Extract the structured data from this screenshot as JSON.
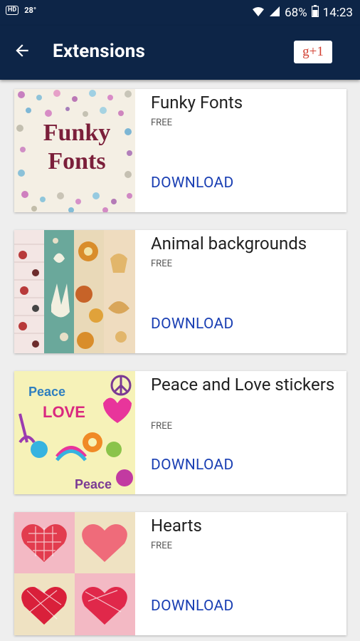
{
  "status_bar": {
    "left_icons": [
      "hd-voice-icon",
      "temperature"
    ],
    "temperature": "28°",
    "battery": "68%",
    "time": "14:23"
  },
  "app_bar": {
    "title": "Extensions",
    "gplus_label": "g+1"
  },
  "extensions": [
    {
      "title": "Funky Fonts",
      "price": "FREE",
      "action": "DOWNLOAD",
      "thumb_text": [
        "Funky",
        "Fonts"
      ]
    },
    {
      "title": "Animal backgrounds",
      "price": "FREE",
      "action": "DOWNLOAD"
    },
    {
      "title": "Peace and Love stickers",
      "price": "FREE",
      "action": "DOWNLOAD",
      "thumb_text": [
        "Peace",
        "LOVE",
        "Peace"
      ]
    },
    {
      "title": "Hearts",
      "price": "FREE",
      "action": "DOWNLOAD"
    }
  ],
  "colors": {
    "app_bar": "#0d2547",
    "link": "#1a3fb3",
    "background": "#eeeeee"
  }
}
